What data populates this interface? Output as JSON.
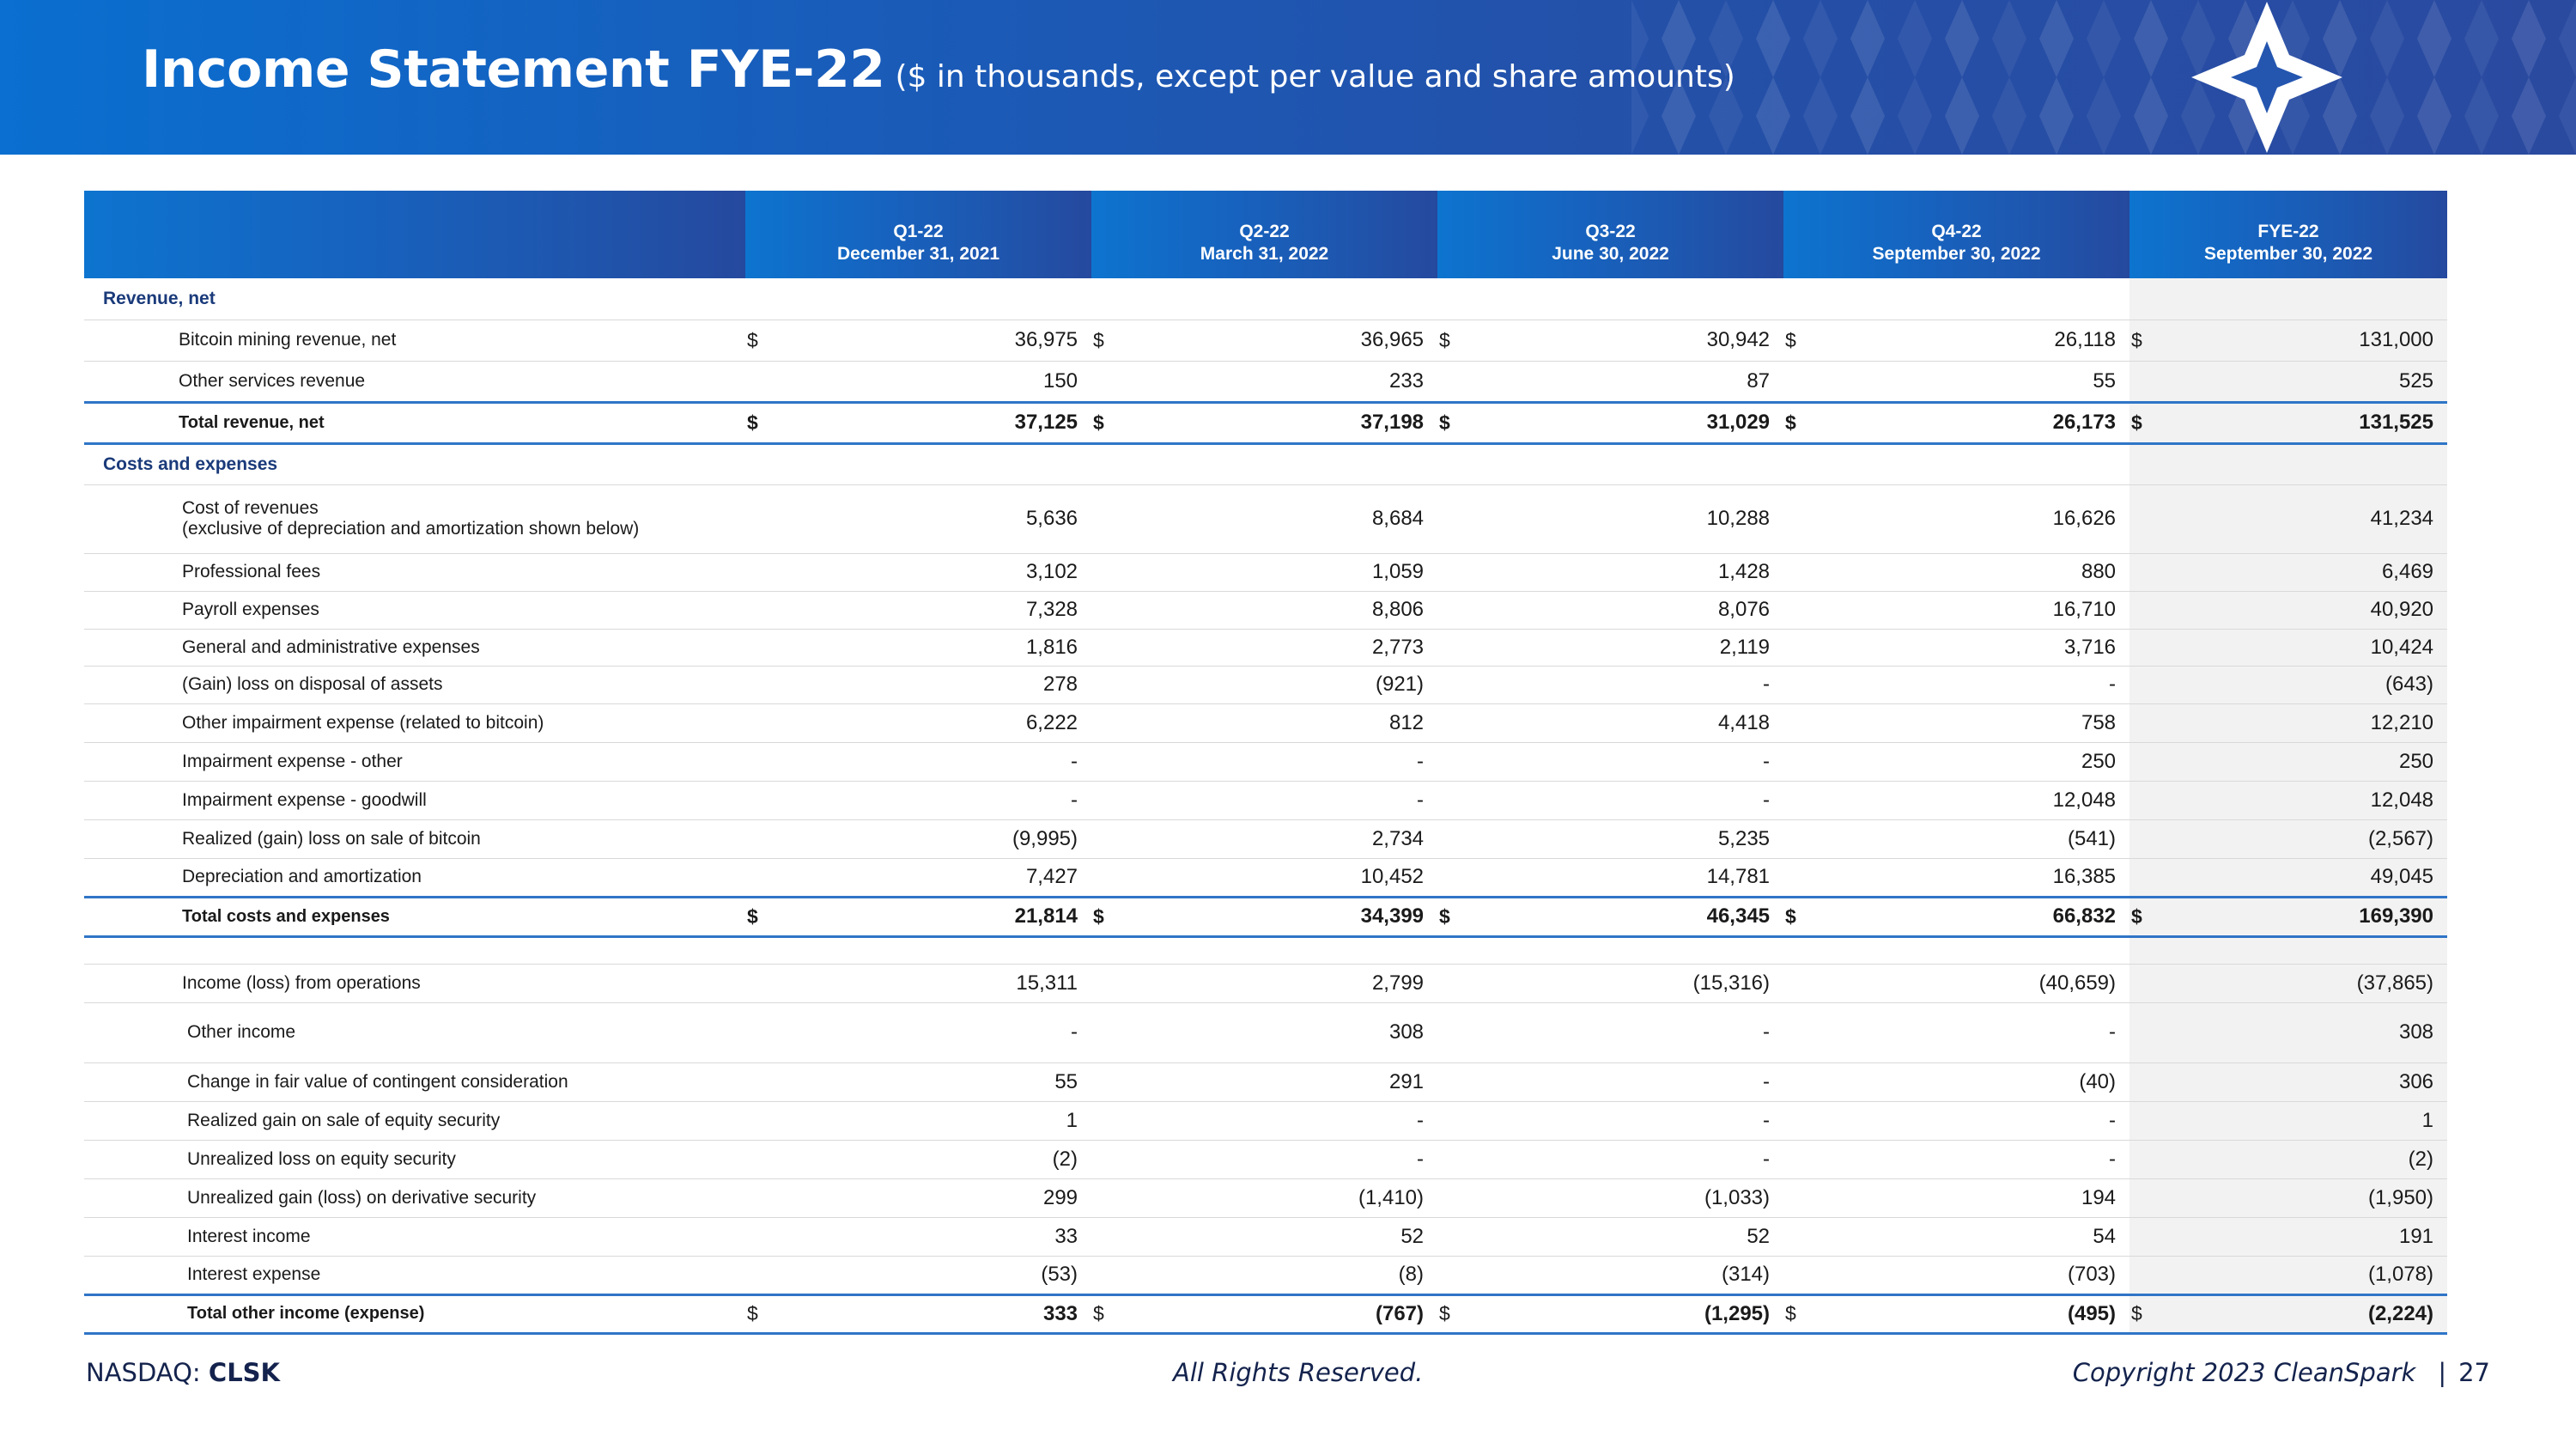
{
  "header": {
    "title": "Income Statement FYE-22",
    "subtitle": "($ in thousands, except per value and share amounts)",
    "logo_icon": "cleanspark-star-icon"
  },
  "columns": [
    {
      "period": "Q1-22",
      "date": "December 31, 2021"
    },
    {
      "period": "Q2-22",
      "date": "March 31, 2022"
    },
    {
      "period": "Q3-22",
      "date": "June 30, 2022"
    },
    {
      "period": "Q4-22",
      "date": "September 30, 2022"
    },
    {
      "period": "FYE-22",
      "date": "September 30, 2022"
    }
  ],
  "currency_symbol": "$",
  "rows": {
    "revenue_section": "Revenue, net",
    "bitcoin_mining": {
      "label": "Bitcoin mining revenue, net",
      "values": [
        "36,975",
        "36,965",
        "30,942",
        "26,118",
        "131,000"
      ]
    },
    "other_services": {
      "label": "Other services revenue",
      "values": [
        "150",
        "233",
        "87",
        "55",
        "525"
      ]
    },
    "total_revenue": {
      "label": "Total revenue, net",
      "values": [
        "37,125",
        "37,198",
        "31,029",
        "26,173",
        "131,525"
      ]
    },
    "costs_section": "Costs and expenses",
    "cost_of_revenues": {
      "label": "Cost of revenues",
      "label2": "(exclusive of depreciation and amortization shown below)",
      "values": [
        "5,636",
        "8,684",
        "10,288",
        "16,626",
        "41,234"
      ]
    },
    "professional_fees": {
      "label": "Professional fees",
      "values": [
        "3,102",
        "1,059",
        "1,428",
        "880",
        "6,469"
      ]
    },
    "payroll": {
      "label": "Payroll expenses",
      "values": [
        "7,328",
        "8,806",
        "8,076",
        "16,710",
        "40,920"
      ]
    },
    "g_and_a": {
      "label": "General and administrative expenses",
      "values": [
        "1,816",
        "2,773",
        "2,119",
        "3,716",
        "10,424"
      ]
    },
    "gain_loss_disposal": {
      "label": "(Gain) loss on disposal of assets",
      "values": [
        "278",
        "(921)",
        "-",
        "-",
        "(643)"
      ]
    },
    "other_impairment": {
      "label": "Other impairment expense (related to bitcoin)",
      "values": [
        "6,222",
        "812",
        "4,418",
        "758",
        "12,210"
      ]
    },
    "impairment_other": {
      "label": "Impairment expense - other",
      "values": [
        "-",
        "-",
        "-",
        "250",
        "250"
      ]
    },
    "impairment_goodwill": {
      "label": "Impairment expense - goodwill",
      "values": [
        "-",
        "-",
        "-",
        "12,048",
        "12,048"
      ]
    },
    "realized_bitcoin": {
      "label": "Realized (gain) loss on sale of bitcoin",
      "values": [
        "(9,995)",
        "2,734",
        "5,235",
        "(541)",
        "(2,567)"
      ]
    },
    "depreciation": {
      "label": "Depreciation and amortization",
      "values": [
        "7,427",
        "10,452",
        "14,781",
        "16,385",
        "49,045"
      ]
    },
    "total_costs": {
      "label": "Total costs and expenses",
      "values": [
        "21,814",
        "34,399",
        "46,345",
        "66,832",
        "169,390"
      ]
    },
    "income_ops": {
      "label": "Income (loss) from operations",
      "values": [
        "15,311",
        "2,799",
        "(15,316)",
        "(40,659)",
        "(37,865)"
      ]
    },
    "other_income": {
      "label": "Other income",
      "values": [
        "-",
        "308",
        "-",
        "-",
        "308"
      ]
    },
    "fair_value_change": {
      "label": "Change in fair value of contingent consideration",
      "values": [
        "55",
        "291",
        "-",
        "(40)",
        "306"
      ]
    },
    "realized_equity": {
      "label": "Realized gain on sale of equity security",
      "values": [
        "1",
        "-",
        "-",
        "-",
        "1"
      ]
    },
    "unrealized_equity": {
      "label": "Unrealized loss on equity security",
      "values": [
        "(2)",
        "-",
        "-",
        "-",
        "(2)"
      ]
    },
    "unrealized_derivative": {
      "label": "Unrealized gain (loss) on derivative security",
      "values": [
        "299",
        "(1,410)",
        "(1,033)",
        "194",
        "(1,950)"
      ]
    },
    "interest_income": {
      "label": "Interest income",
      "values": [
        "33",
        "52",
        "52",
        "54",
        "191"
      ]
    },
    "interest_expense": {
      "label": "Interest expense",
      "values": [
        "(53)",
        "(8)",
        "(314)",
        "(703)",
        "(1,078)"
      ]
    },
    "total_other": {
      "label": "Total other income (expense)",
      "values": [
        "333",
        "(767)",
        "(1,295)",
        "(495)",
        "(2,224)"
      ]
    }
  },
  "footer": {
    "exchange": "NASDAQ:",
    "ticker": "CLSK",
    "rights": "All Rights Reserved.",
    "copyright": "Copyright 2023 CleanSpark",
    "separator": "|",
    "page": "27"
  },
  "colors": {
    "header_start": "#0a6fd0",
    "header_end": "#2a4aa0",
    "section_text": "#1a3a7a",
    "total_rule": "#2f75c7",
    "fy_column_bg": "#f2f2f2"
  }
}
